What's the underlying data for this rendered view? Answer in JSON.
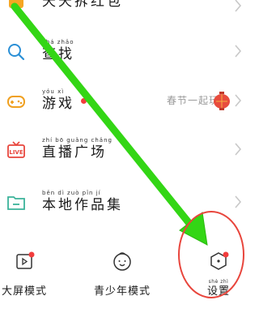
{
  "menu": [
    {
      "pinyin": "",
      "label": "天天拆红包"
    },
    {
      "pinyin": "chá zhǎo",
      "label": "查找"
    },
    {
      "pinyin": "yóu xì",
      "label": "游戏",
      "promo": "春节一起玩"
    },
    {
      "pinyin": "zhí bō guǎng chǎng",
      "label": "直播广场"
    },
    {
      "pinyin": "běn dì zuò pǐn jí",
      "label": "本地作品集"
    }
  ],
  "tabs": [
    {
      "pinyin": "",
      "label": "大屏模式"
    },
    {
      "pinyin": "",
      "label": "青少年模式"
    },
    {
      "pinyin": "shè zhì",
      "label": "设置"
    }
  ],
  "colors": {
    "accent": "#f5a623",
    "search": "#2a8fd6",
    "game": "#f0a020",
    "live": "#e8453c",
    "folder": "#3bb39a",
    "arrow": "#33d615",
    "circle": "#e8453c"
  }
}
